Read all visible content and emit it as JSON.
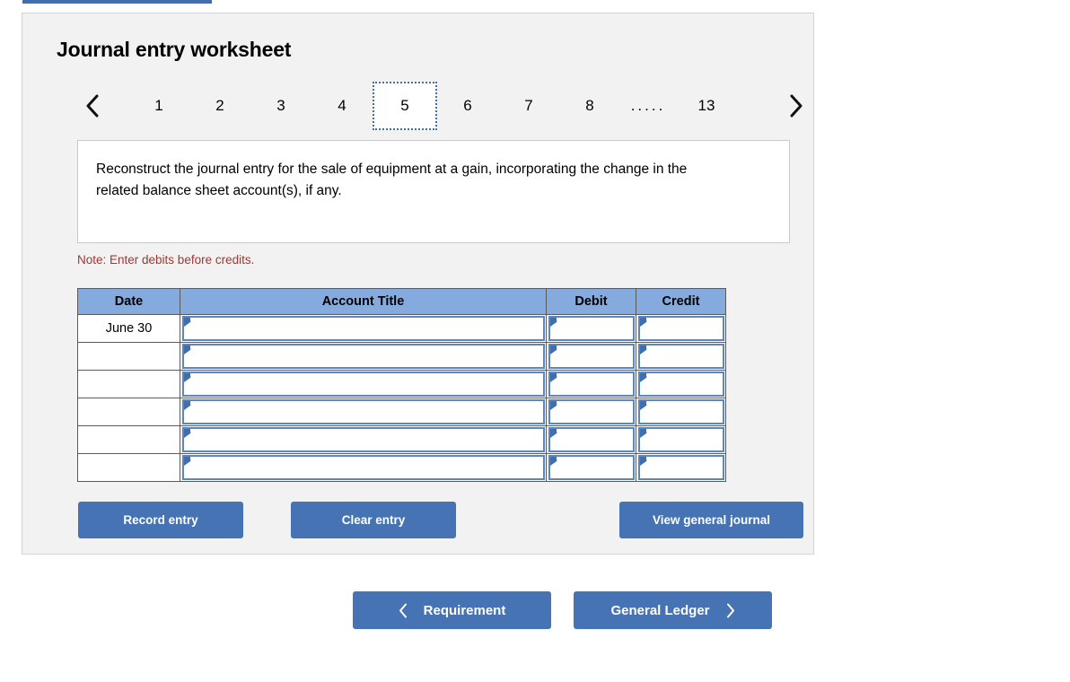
{
  "top_bar": {
    "color": "#3f6fad"
  },
  "panel": {
    "title": "Journal entry worksheet",
    "background": "#f2f2f2"
  },
  "pager": {
    "prev_icon": "chevron-left-icon",
    "next_icon": "chevron-right-icon",
    "tabs": [
      {
        "label": "1",
        "selected": false
      },
      {
        "label": "2",
        "selected": false
      },
      {
        "label": "3",
        "selected": false
      },
      {
        "label": "4",
        "selected": false
      },
      {
        "label": "5",
        "selected": true
      },
      {
        "label": "6",
        "selected": false
      },
      {
        "label": "7",
        "selected": false
      },
      {
        "label": "8",
        "selected": false
      },
      {
        "label": ".....",
        "selected": false
      },
      {
        "label": "13",
        "selected": false
      }
    ]
  },
  "instruction": {
    "text": "Reconstruct the journal entry for the sale of equipment at a gain, incorporating the change in the related balance sheet account(s), if any."
  },
  "note": {
    "text": "Note: Enter debits before credits.",
    "color": "#a33632"
  },
  "journal_table": {
    "header_color": "#85aade",
    "columns": [
      "Date",
      "Account Title",
      "Debit",
      "Credit"
    ],
    "rows": [
      {
        "date": "June 30",
        "account_title": "",
        "debit": "",
        "credit": ""
      },
      {
        "date": "",
        "account_title": "",
        "debit": "",
        "credit": ""
      },
      {
        "date": "",
        "account_title": "",
        "debit": "",
        "credit": ""
      },
      {
        "date": "",
        "account_title": "",
        "debit": "",
        "credit": ""
      },
      {
        "date": "",
        "account_title": "",
        "debit": "",
        "credit": ""
      },
      {
        "date": "",
        "account_title": "",
        "debit": "",
        "credit": ""
      }
    ]
  },
  "actions": {
    "record_entry": "Record entry",
    "clear_entry": "Clear entry",
    "view_general_journal": "View general journal",
    "button_color": "#4673b3"
  },
  "footer_nav": {
    "requirement": "Requirement",
    "general_ledger": "General Ledger",
    "prev_icon": "chevron-left-icon",
    "next_icon": "chevron-right-icon"
  }
}
